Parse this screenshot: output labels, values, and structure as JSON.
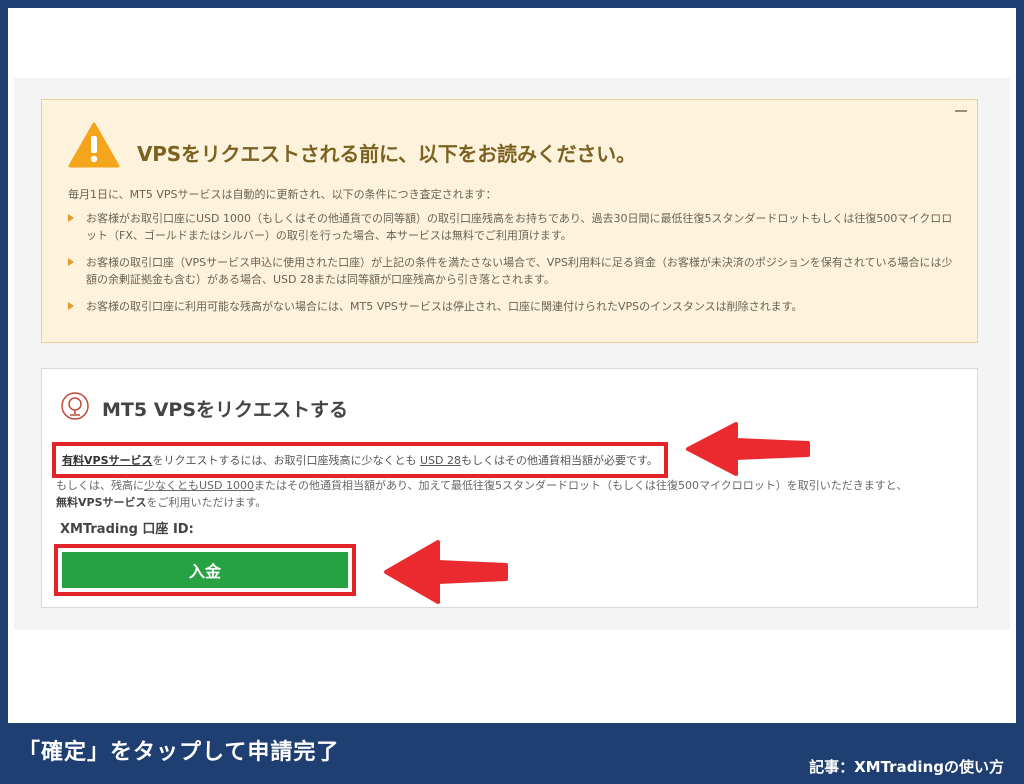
{
  "warning": {
    "title": "VPSをリクエストされる前に、以下をお読みください。",
    "intro": "毎月1日に、MT5 VPSサービスは自動的に更新され、以下の条件につき査定されます：",
    "items": [
      "お客様がお取引口座にUSD 1000（もしくはその他通貨での同等額）の取引口座残高をお持ちであり、過去30日間に最低往復5スタンダードロットもしくは往復500マイクロロット（FX、ゴールドまたはシルバー）の取引を行った場合、本サービスは無料でご利用頂けます。",
      "お客様の取引口座（VPSサービス申込に使用された口座）が上記の条件を満たさない場合で、VPS利用料に足る資金（お客様が未決済のポジションを保有されている場合には少額の余剰証拠金も含む）がある場合、USD 28または同等額が口座残高から引き落とされます。",
      "お客様の取引口座に利用可能な残高がない場合には、MT5 VPSサービスは停止され、口座に関連付けられたVPSのインスタンスは削除されます。"
    ],
    "icon": "warning-triangle-icon",
    "accent": "#f4a51c"
  },
  "request": {
    "title": "MT5 VPSをリクエストする",
    "icon": "request-icon",
    "line1": {
      "paid_vps": "有料VPSサービス",
      "mid": "をリクエストするには、お取引口座残高に少なくとも",
      "amount": "USD 28",
      "tail": "もしくはその他通貨相当額が必要です。"
    },
    "line2": {
      "a": "もしくは、残高に",
      "b": "少なくともUSD 1000",
      "c": "またはその他通貨相当額があり、加えて最低往復5スタンダードロット（もしくは往復500マイクロロット）を取引いただきますと、",
      "d": "無料VPSサービス",
      "e": "をご利用いただけます。"
    },
    "account_label": "XMTrading 口座 ID:",
    "deposit_label": "入金",
    "button_color": "#27a243",
    "highlight_color": "#e2232a"
  },
  "footer": {
    "caption": "「確定」をタップして申請完了",
    "credit": "記事：XMTradingの使い方"
  }
}
